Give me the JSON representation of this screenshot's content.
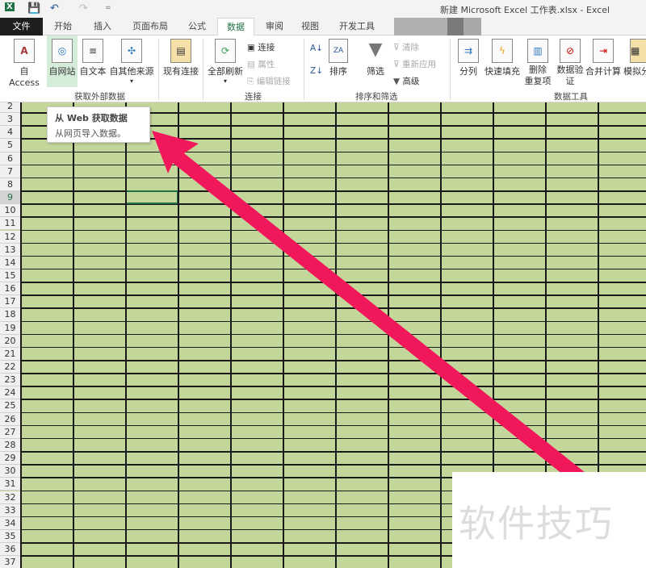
{
  "title": "新建 Microsoft Excel 工作表.xlsx - Excel",
  "quick_access": {
    "excel_icon": "X",
    "save": "💾",
    "undo": "↶",
    "redo": "↷",
    "customize": "="
  },
  "tabs": [
    "文件",
    "开始",
    "插入",
    "页面布局",
    "公式",
    "数据",
    "审阅",
    "视图",
    "开发工具"
  ],
  "active_tab": "数据",
  "ribbon": {
    "get_external": {
      "label": "获取外部数据",
      "items": [
        "自 Access",
        "自网站",
        "自文本",
        "自其他来源",
        "现有连接"
      ]
    },
    "connections": {
      "label": "连接",
      "refresh_all": "全部刷新",
      "items": [
        "连接",
        "属性",
        "编辑链接"
      ]
    },
    "sort_filter": {
      "label": "排序和筛选",
      "sort": "排序",
      "filter": "筛选",
      "items": [
        "清除",
        "重新应用",
        "高级"
      ]
    },
    "data_tools": {
      "label": "数据工具",
      "items": [
        "分列",
        "快速填充",
        "删除\n重复项",
        "数据验\n证",
        "合并计算",
        "模拟分"
      ]
    }
  },
  "tooltip": {
    "title": "从 Web 获取数据",
    "body": "从网页导入数据。"
  },
  "rows": [
    "2",
    "3",
    "4",
    "5",
    "6",
    "7",
    "8",
    "9",
    "10",
    "11",
    "12",
    "13",
    "14",
    "15",
    "16",
    "17",
    "18",
    "19",
    "20",
    "21",
    "22",
    "23",
    "24",
    "25",
    "26",
    "27",
    "28",
    "29",
    "30",
    "31",
    "32",
    "33",
    "34",
    "35",
    "36",
    "37"
  ],
  "selected_row": "9",
  "watermark": "软件技巧",
  "colors": {
    "cell_fill": "#c4d79b",
    "accent": "#217346",
    "arrow": "#f0185a"
  }
}
